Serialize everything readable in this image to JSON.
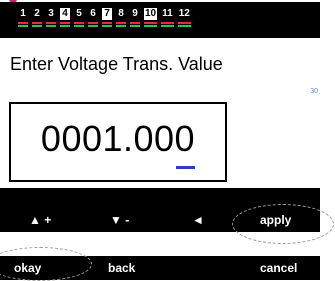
{
  "tabs": [
    {
      "label": "1",
      "active": false
    },
    {
      "label": "2",
      "active": false
    },
    {
      "label": "3",
      "active": false
    },
    {
      "label": "4",
      "active": true
    },
    {
      "label": "5",
      "active": false
    },
    {
      "label": "6",
      "active": false
    },
    {
      "label": "7",
      "active": true
    },
    {
      "label": "8",
      "active": false
    },
    {
      "label": "9",
      "active": false
    },
    {
      "label": "10",
      "active": true
    },
    {
      "label": "11",
      "active": false
    },
    {
      "label": "12",
      "active": false
    }
  ],
  "screen": {
    "title": "Enter Voltage Trans. Value",
    "side_number": "30",
    "value": "0001.000"
  },
  "softkeys": {
    "increment": "▲ +",
    "decrement": "▼ -",
    "left": "◄",
    "apply": "apply"
  },
  "bottom_bar": {
    "okay": "okay",
    "back": "back",
    "cancel": "cancel"
  },
  "colors": {
    "marker": "#e0147a",
    "tab_bar_red": "#e03030",
    "tab_bar_green": "#29c24a",
    "cursor": "#2b3cc8",
    "side_number": "#5b8bd8"
  }
}
